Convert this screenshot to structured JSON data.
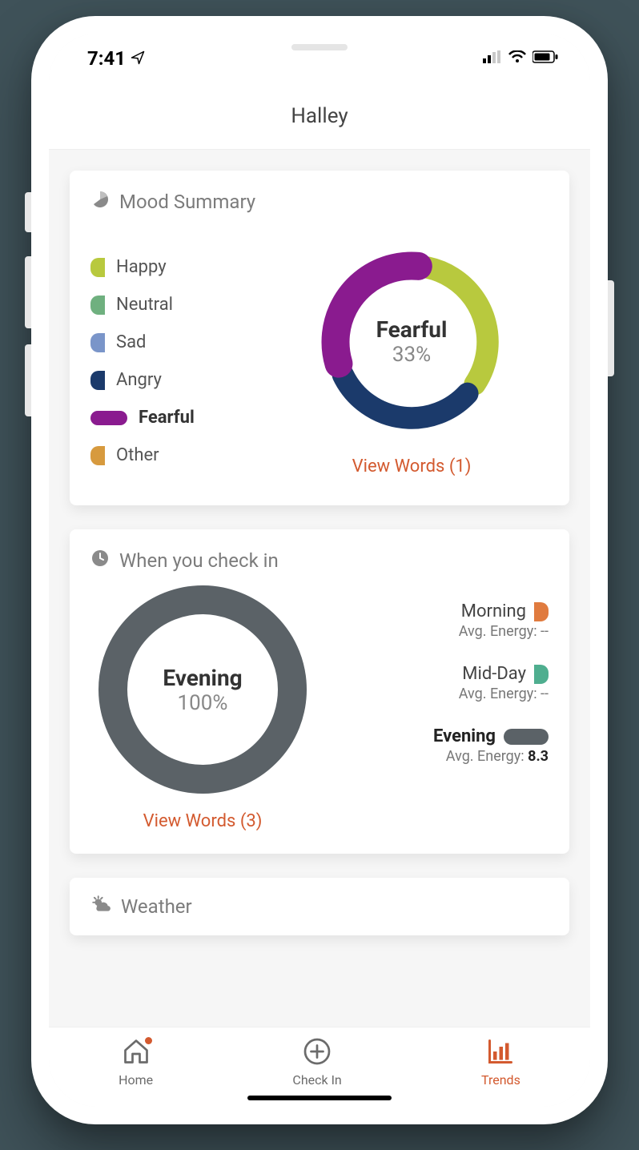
{
  "status": {
    "time": "7:41"
  },
  "header": {
    "title": "Halley"
  },
  "mood_card": {
    "title": "Mood Summary",
    "legend": [
      {
        "label": "Happy",
        "color": "#b8c93e"
      },
      {
        "label": "Neutral",
        "color": "#6fb07f"
      },
      {
        "label": "Sad",
        "color": "#7a95c9"
      },
      {
        "label": "Angry",
        "color": "#1b3a6b"
      },
      {
        "label": "Fearful",
        "color": "#8a1b8f",
        "active": true
      },
      {
        "label": "Other",
        "color": "#d79a3e"
      }
    ],
    "center_label": "Fearful",
    "center_pct": "33%",
    "view_words": "View Words (1)"
  },
  "checkin_card": {
    "title": "When you check in",
    "center_label": "Evening",
    "center_pct": "100%",
    "times": [
      {
        "label": "Morning",
        "energy": "--",
        "color": "#e07b3f"
      },
      {
        "label": "Mid-Day",
        "energy": "--",
        "color": "#4fae8f"
      },
      {
        "label": "Evening",
        "energy": "8.3",
        "color": "#5b6267",
        "active": true
      }
    ],
    "view_words": "View Words (3)"
  },
  "weather_card": {
    "title": "Weather"
  },
  "nav": {
    "home": "Home",
    "checkin": "Check In",
    "trends": "Trends"
  },
  "chart_data": [
    {
      "type": "pie",
      "title": "Mood Summary",
      "series": [
        {
          "name": "Fearful",
          "value": 33,
          "color": "#8a1b8f"
        },
        {
          "name": "Happy",
          "value": 33,
          "color": "#b8c93e"
        },
        {
          "name": "Angry",
          "value": 33,
          "color": "#1b3a6b"
        }
      ],
      "highlight": "Fearful"
    },
    {
      "type": "pie",
      "title": "When you check in",
      "series": [
        {
          "name": "Evening",
          "value": 100,
          "color": "#5b6267"
        }
      ],
      "highlight": "Evening"
    }
  ]
}
